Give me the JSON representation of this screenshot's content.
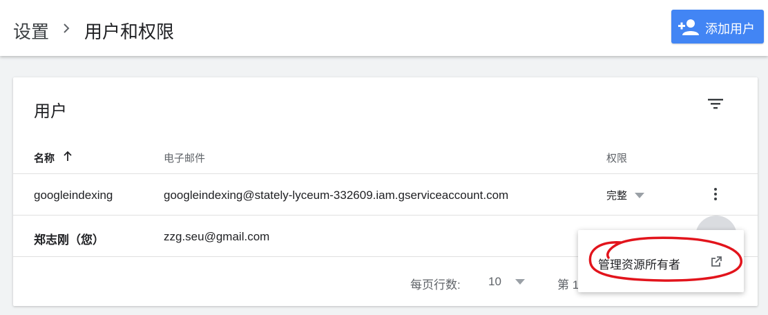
{
  "header": {
    "breadcrumb_root": "设置",
    "breadcrumb_current": "用户和权限",
    "add_user_label": "添加用户"
  },
  "card": {
    "title": "用户",
    "columns": {
      "name": "名称",
      "email": "电子邮件",
      "permission": "权限"
    },
    "rows": [
      {
        "name": "googleindexing",
        "email": "googleindexing@stately-lyceum-332609.iam.gserviceaccount.com",
        "permission": "完整"
      },
      {
        "name": "郑志刚（您）",
        "email": "zzg.seu@gmail.com",
        "permission": ""
      }
    ],
    "footer": {
      "rows_per_page_label": "每页行数:",
      "rows_per_page_value": "10",
      "page_label": "第 1"
    }
  },
  "context_menu": {
    "item_label": "管理资源所有者"
  },
  "colors": {
    "accent": "#4285f4",
    "annotation": "#e2141c"
  },
  "icons": [
    "chevron-right-icon",
    "person-add-icon",
    "filter-icon",
    "arrow-up-icon",
    "caret-down-icon",
    "more-vert-icon",
    "open-in-new-icon"
  ]
}
